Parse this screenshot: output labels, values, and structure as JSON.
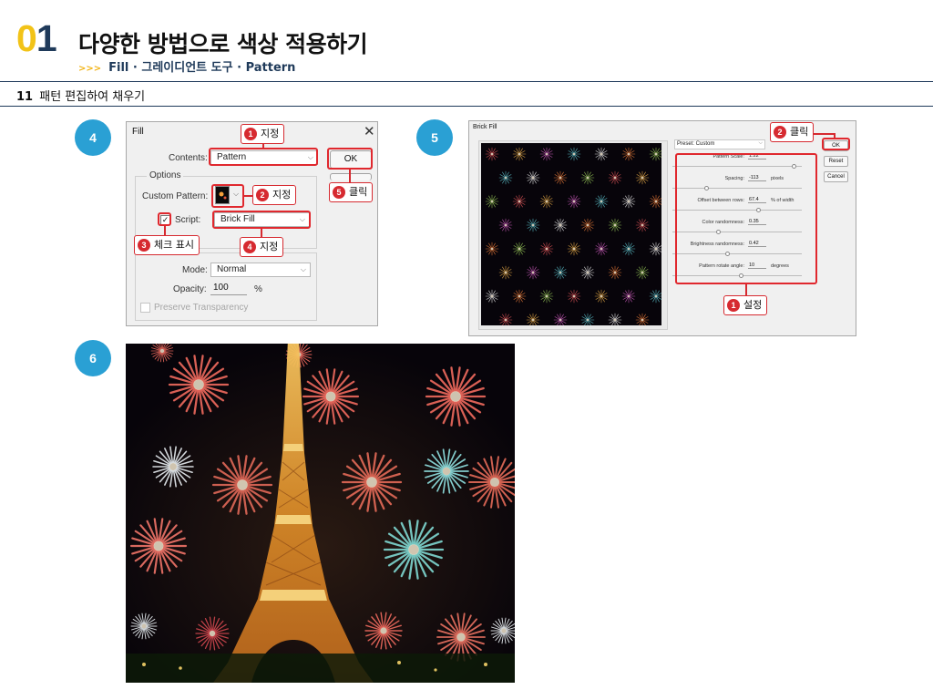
{
  "header": {
    "chapter_digit_0": "0",
    "chapter_digit_1": "1",
    "title": "다양한 방법으로 색상 적용하기",
    "subtitle_arrows": ">>>",
    "subtitle": "Fill · 그레이디언트 도구 · Pattern"
  },
  "section": {
    "number": "11",
    "title": "패턴 편집하여 채우기"
  },
  "steps": {
    "s4": "4",
    "s5": "5",
    "s6": "6"
  },
  "fill_dialog": {
    "title": "Fill",
    "close_glyph": "✕",
    "contents_label": "Contents:",
    "contents_value": "Pattern",
    "options_label": "Options",
    "custom_pattern_label": "Custom Pattern:",
    "script_label": "Script:",
    "script_value": "Brick Fill",
    "script_checked": true,
    "mode_label": "Mode:",
    "mode_value": "Normal",
    "opacity_label": "Opacity:",
    "opacity_value": "100",
    "opacity_unit": "%",
    "preserve_label": "Preserve Transparency",
    "ok_label": "OK",
    "callouts": {
      "c1": {
        "num": "1",
        "text": "지정"
      },
      "c2": {
        "num": "2",
        "text": "지정"
      },
      "c3": {
        "num": "3",
        "text": "체크 표시"
      },
      "c4": {
        "num": "4",
        "text": "지정"
      },
      "c5": {
        "num": "5",
        "text": "클릭"
      }
    }
  },
  "brick_fill_dialog": {
    "title": "Brick Fill",
    "preset": "Preset: Custom",
    "params": [
      {
        "label": "Pattern Scale:",
        "value": "1.22",
        "unit": "",
        "level": 0.95
      },
      {
        "label": "Spacing:",
        "value": "-113",
        "unit": "pixels",
        "level": 0.25
      },
      {
        "label": "Offset between rows:",
        "value": "67.4",
        "unit": "% of width",
        "level": 0.67
      },
      {
        "label": "Color randomness:",
        "value": "0.35",
        "unit": "",
        "level": 0.35
      },
      {
        "label": "Brightness randomness:",
        "value": "0.42",
        "unit": "",
        "level": 0.42
      },
      {
        "label": "Pattern rotate angle:",
        "value": "10",
        "unit": "degrees",
        "level": 0.53
      }
    ],
    "ok_label": "OK",
    "reset_label": "Reset",
    "cancel_label": "Cancel",
    "callouts": {
      "c1": {
        "num": "1",
        "text": "설정"
      },
      "c2": {
        "num": "2",
        "text": "클릭"
      }
    }
  },
  "colors": {
    "accent_blue": "#2aa0d4",
    "accent_yellow": "#f2c318",
    "navy": "#1f3a5a",
    "callout_red": "#d62a30"
  }
}
